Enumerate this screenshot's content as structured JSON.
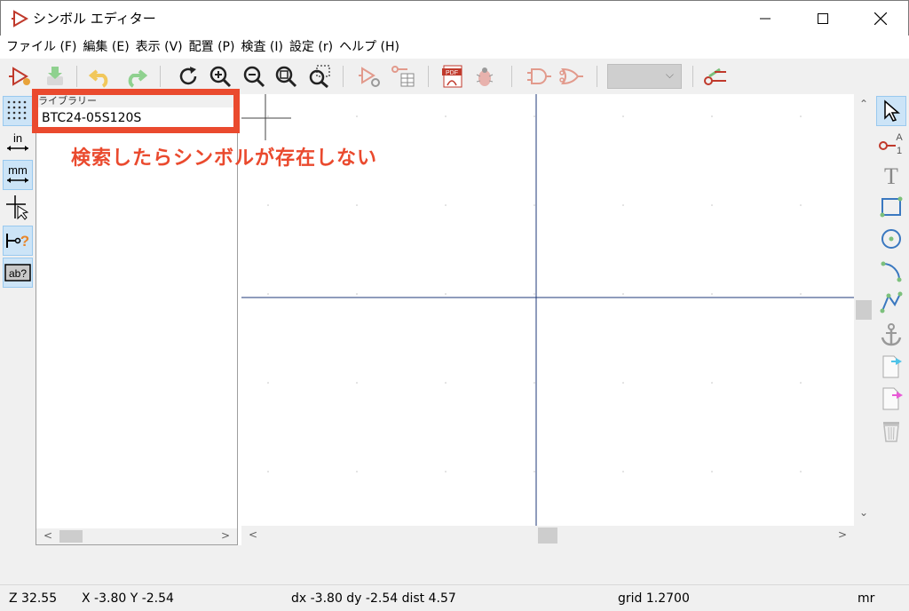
{
  "window": {
    "title": "シンボル エディター"
  },
  "menu": [
    "ファイル (F)",
    "編集 (E)",
    "表示 (V)",
    "配置 (P)",
    "検査 (I)",
    "設定 (r)",
    "ヘルプ (H)"
  ],
  "library": {
    "header": "ライブラリー",
    "item": "BTC24-05S120S"
  },
  "annotation": "検索したらシンボルが存在しない",
  "status": {
    "zoom": "Z 32.55",
    "xy": "X -3.80  Y -2.54",
    "delta": "dx -3.80  dy -2.54  dist 4.57",
    "grid": "grid 1.2700",
    "units": "mr"
  },
  "colors": {
    "annotation": "#ea4a2e",
    "axis": "#1f3a7a",
    "active_tool": "#cce4f7"
  },
  "icons": {
    "toolbar": [
      "new-symbol-icon",
      "save-icon",
      "undo-icon",
      "redo-icon",
      "refresh-icon",
      "zoom-in-icon",
      "zoom-out-icon",
      "zoom-fit-icon",
      "zoom-selection-icon",
      "symbol-properties-icon",
      "pin-table-icon",
      "pdf-icon",
      "erc-bug-icon",
      "deMorgan-normal-icon",
      "deMorgan-alt-icon",
      "unit-select",
      "pin-settings-icon"
    ],
    "left": [
      "grid-icon",
      "inches-icon",
      "millimeters-icon",
      "cursor-shape-icon",
      "pin-type-icon",
      "hidden-text-icon"
    ],
    "right": [
      "select-icon",
      "add-pin-icon",
      "add-text-icon",
      "add-rectangle-icon",
      "add-circle-icon",
      "add-arc-icon",
      "add-line-icon",
      "anchor-icon",
      "import-icon",
      "export-icon",
      "delete-icon"
    ]
  }
}
